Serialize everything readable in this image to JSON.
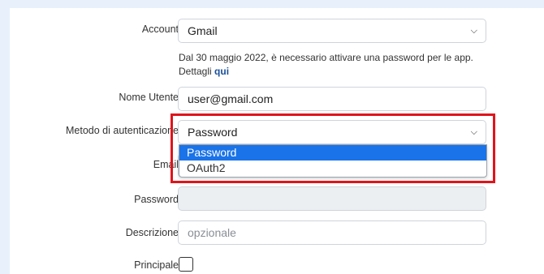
{
  "form": {
    "account": {
      "label": "Account",
      "value": "Gmail"
    },
    "help": {
      "text": "Dal 30 maggio 2022, è necessario attivare una password per le app. Dettagli ",
      "link": "qui"
    },
    "username": {
      "label": "Nome Utente",
      "value": "user@gmail.com"
    },
    "auth_method": {
      "label": "Metodo di autenticazione",
      "value": "Password",
      "options": [
        "Password",
        "OAuth2"
      ],
      "selected": "Password"
    },
    "email": {
      "label": "Email",
      "value": ""
    },
    "password": {
      "label": "Password",
      "value": ""
    },
    "description": {
      "label": "Descrizione",
      "placeholder": "opzionale"
    },
    "primary": {
      "label": "Principale",
      "checked": false
    }
  },
  "colors": {
    "highlight": "#e0141c",
    "selected_option": "#1a73e8",
    "page_bg": "#e8f1fb"
  },
  "icons": {
    "select_arrow": "chevron-down-icon"
  }
}
